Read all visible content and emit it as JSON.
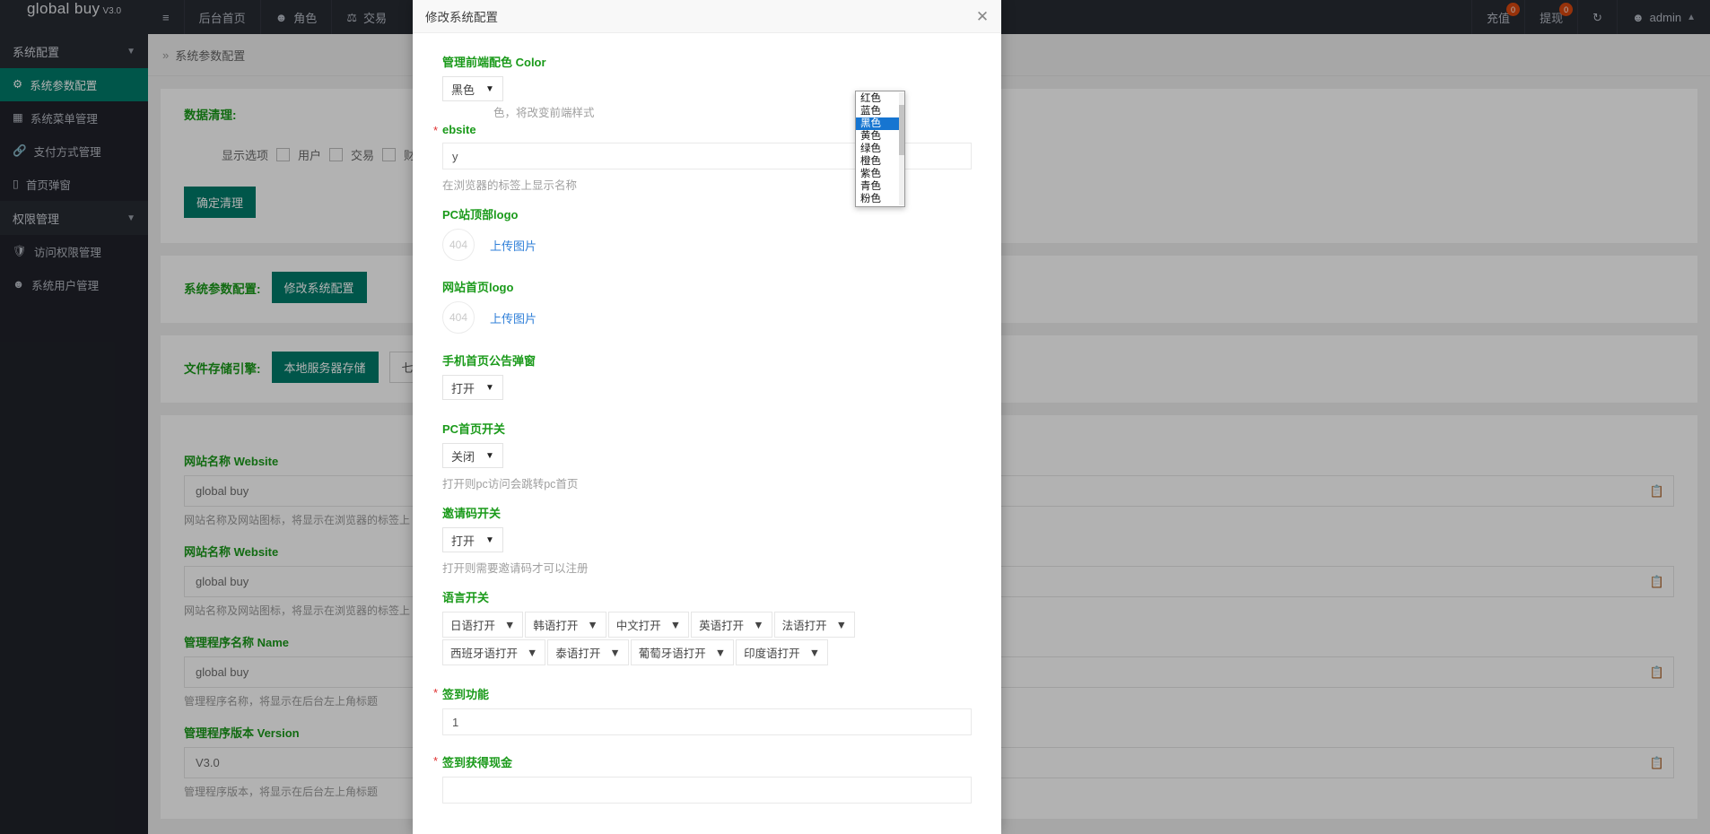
{
  "topbar": {
    "brand_name": "global buy",
    "brand_version": "V3.0",
    "menu_icon": "hamburger-icon",
    "nav": [
      {
        "label": "后台首页",
        "icon": ""
      },
      {
        "label": "角色",
        "icon": "user-icon"
      },
      {
        "label": "交易",
        "icon": "scales-icon"
      }
    ],
    "right": [
      {
        "label": "充值",
        "badge": "0"
      },
      {
        "label": "提现",
        "badge": "0"
      }
    ],
    "refresh_icon": "refresh-icon",
    "user_icon": "user-icon",
    "user_name": "admin",
    "user_caret": "chevron-up-icon"
  },
  "sidebar": {
    "groups": [
      {
        "label": "系统配置",
        "items": [
          {
            "label": "系统参数配置",
            "icon": "gear-icon",
            "active": true
          },
          {
            "label": "系统菜单管理",
            "icon": "table-icon",
            "active": false
          },
          {
            "label": "支付方式管理",
            "icon": "link-icon",
            "active": false
          },
          {
            "label": "首页弹窗",
            "icon": "mobile-icon",
            "active": false
          }
        ]
      },
      {
        "label": "权限管理",
        "items": [
          {
            "label": "访问权限管理",
            "icon": "shield-icon",
            "active": false
          },
          {
            "label": "系统用户管理",
            "icon": "user-icon",
            "active": false
          }
        ]
      }
    ]
  },
  "page": {
    "breadcrumb": "系统参数配置",
    "clean": {
      "title": "数据清理:",
      "options_label": "显示选项",
      "checkboxes": [
        "用户",
        "交易",
        "财务"
      ],
      "confirm_button": "确定清理"
    },
    "sysconf": {
      "label": "系统参数配置:",
      "button": "修改系统配置"
    },
    "storage": {
      "label": "文件存储引擎:",
      "buttons": [
        "本地服务器存储",
        "七牛云对象存储"
      ]
    },
    "fields": [
      {
        "label": "网站名称 Website",
        "value": "global buy",
        "hint": "网站名称及网站图标，将显示在浏览器的标签上"
      },
      {
        "label": "网站名称 Website",
        "value": "global buy",
        "hint": "网站名称及网站图标，将显示在浏览器的标签上"
      },
      {
        "label": "管理程序名称 Name",
        "value": "global buy",
        "hint": "管理程序名称，将显示在后台左上角标题"
      },
      {
        "label": "管理程序版本 Version",
        "value": "V3.0",
        "hint": "管理程序版本，将显示在后台左上角标题"
      }
    ]
  },
  "modal": {
    "title": "修改系统配置",
    "close_icon": "close-icon",
    "color_field": {
      "label": "管理前端配色 Color",
      "value": "黑色",
      "hint": "色，将改变前端样式",
      "options": [
        "红色",
        "蓝色",
        "黑色",
        "黄色",
        "绿色",
        "橙色",
        "紫色",
        "青色",
        "粉色"
      ],
      "selected_index": 2
    },
    "website_field": {
      "label": "ebsite",
      "value": "y",
      "hint": "在浏览器的标签上显示名称",
      "required": true
    },
    "pclogo": {
      "label": "PC站顶部logo",
      "placeholder": "404",
      "link": "上传图片"
    },
    "homelogo": {
      "label": "网站首页logo",
      "placeholder": "404",
      "link": "上传图片"
    },
    "mobile_popup": {
      "label": "手机首页公告弹窗",
      "value": "打开"
    },
    "pc_switch": {
      "label": "PC首页开关",
      "value": "关闭",
      "hint": "打开则pc访问会跳转pc首页"
    },
    "invite_switch": {
      "label": "邀请码开关",
      "value": "打开",
      "hint": "打开则需要邀请码才可以注册"
    },
    "lang_switch": {
      "label": "语言开关",
      "items": [
        "日语打开",
        "韩语打开",
        "中文打开",
        "英语打开",
        "法语打开",
        "西班牙语打开",
        "泰语打开",
        "葡萄牙语打开",
        "印度语打开"
      ]
    },
    "signin_func": {
      "label": "签到功能",
      "value": "1",
      "required": true
    },
    "signin_cash": {
      "label": "签到获得现金",
      "value": "",
      "required": true
    }
  },
  "colors": {
    "accent_teal": "#017b6a",
    "label_green": "#1a9a1a",
    "sidebar_dark": "#20222a",
    "topbar_dark": "#282b33",
    "badge_orange": "#d9480f",
    "link_blue": "#2f7fd8",
    "highlight_blue": "#1675d1",
    "required_red": "#e03131"
  }
}
